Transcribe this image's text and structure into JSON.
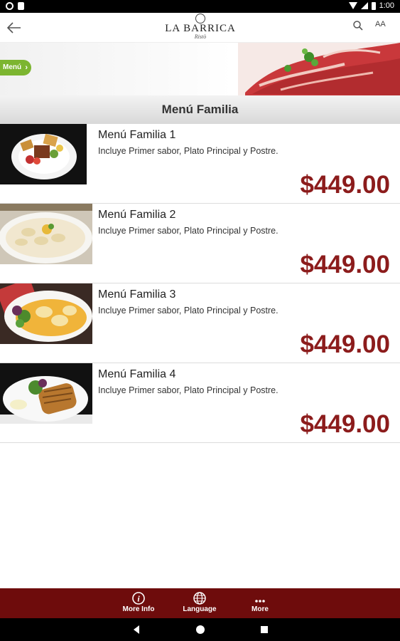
{
  "status_bar": {
    "time": "1:00"
  },
  "app_bar": {
    "logo_name": "LA BARRICA",
    "logo_sub": "Ristò",
    "font_size_label": "AA"
  },
  "banner": {
    "tag_label": "Menú"
  },
  "section": {
    "title": "Menú Familia"
  },
  "items": [
    {
      "title": "Menú Familia 1",
      "description": "Incluye Primer sabor, Plato Principal y Postre.",
      "price": "$449.00"
    },
    {
      "title": "Menú Familia 2",
      "description": "Incluye Primer sabor, Plato Principal y Postre.",
      "price": "$449.00"
    },
    {
      "title": "Menú Familia 3",
      "description": "Incluye Primer sabor, Plato Principal y Postre.",
      "price": "$449.00"
    },
    {
      "title": "Menú Familia 4",
      "description": "Incluye Primer sabor, Plato Principal y Postre.",
      "price": "$449.00"
    }
  ],
  "bottom_nav": {
    "more_info": "More Info",
    "language": "Language",
    "more": "More"
  },
  "colors": {
    "accent": "#8c1c1c",
    "nav_bg": "#6e0c0c",
    "tag_green": "#7cb530"
  },
  "icons": [
    "back-arrow-icon",
    "search-icon",
    "font-size-icon",
    "info-icon",
    "globe-icon",
    "more-dots-icon",
    "android-back-icon",
    "android-home-icon",
    "android-recents-icon"
  ]
}
